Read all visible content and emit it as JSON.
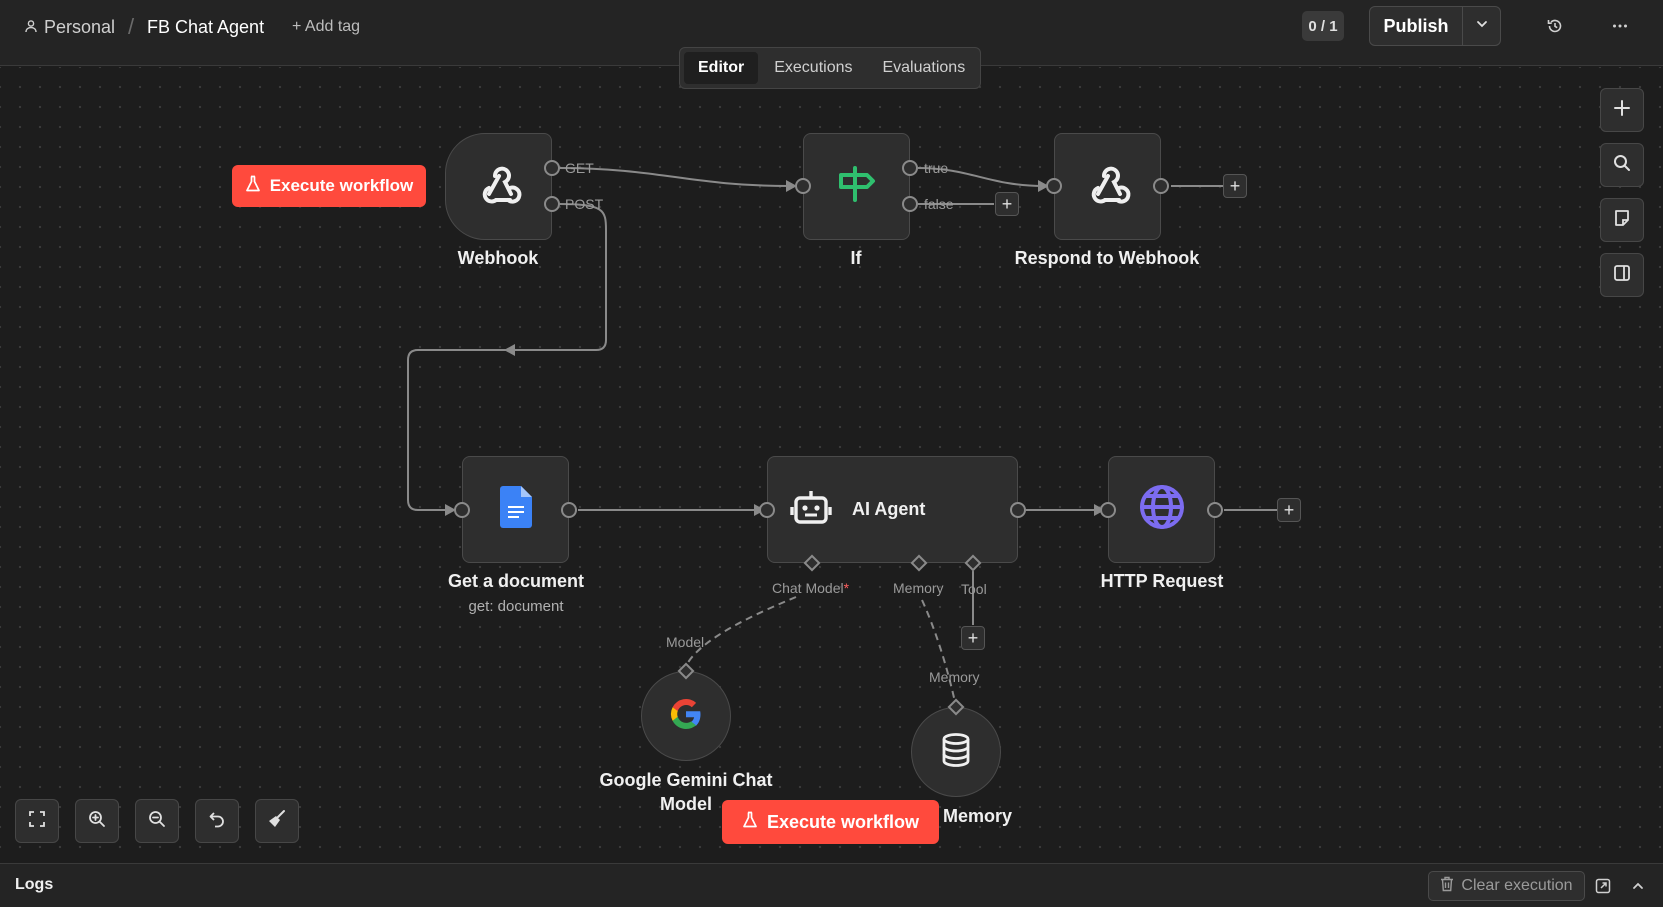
{
  "header": {
    "breadcrumb_personal": "Personal",
    "breadcrumb_separator": "/",
    "workflow_title": "FB Chat Agent",
    "add_tag": "+ Add tag",
    "counter": "0 / 1",
    "publish_label": "Publish"
  },
  "tabs": [
    {
      "label": "Editor",
      "active": true
    },
    {
      "label": "Executions",
      "active": false
    },
    {
      "label": "Evaluations",
      "active": false
    }
  ],
  "canvas": {
    "execute_workflow_label": "Execute workflow",
    "nodes": {
      "webhook": {
        "label": "Webhook",
        "outputs": [
          "GET",
          "POST"
        ]
      },
      "if": {
        "label": "If",
        "outputs": [
          "true",
          "false"
        ]
      },
      "respond": {
        "label": "Respond to Webhook"
      },
      "get_document": {
        "label": "Get a document",
        "subtitle": "get: document"
      },
      "ai_agent": {
        "label": "AI Agent",
        "inputs": {
          "chat_model": "Chat Model",
          "chat_model_required": "*",
          "memory": "Memory",
          "tool": "Tool"
        }
      },
      "http_request": {
        "label": "HTTP Request"
      },
      "gemini": {
        "label_line1": "Google Gemini Chat",
        "label_line2": "Model",
        "connector": "Model"
      },
      "memory": {
        "label": "e Memory",
        "connector": "Memory"
      }
    },
    "plus": "+"
  },
  "logs": {
    "title": "Logs",
    "clear_execution": "Clear execution"
  },
  "icons": {
    "personal": "user-icon",
    "publish_caret": "chevron-down-icon",
    "history": "history-icon",
    "more": "ellipsis-icon",
    "execute": "flask-icon",
    "side_add": "plus-icon",
    "side_search": "search-icon",
    "side_sticky": "sticky-note-icon",
    "side_panel": "panel-icon",
    "fit": "fit-view-icon",
    "zoom_in": "zoom-in-icon",
    "zoom_out": "zoom-out-icon",
    "reset": "undo-icon",
    "tidy": "broom-icon"
  },
  "colors": {
    "accent": "#ff4a3d",
    "if_icon": "#2fbf6e",
    "http_icon": "#7c6cf0",
    "doc_icon": "#3b82f6"
  }
}
